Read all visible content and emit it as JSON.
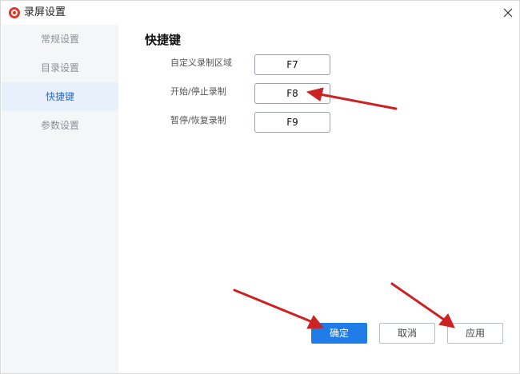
{
  "window": {
    "title": "录屏设置",
    "close_label": "✕"
  },
  "sidebar": {
    "items": [
      {
        "label": "常规设置",
        "active": false
      },
      {
        "label": "目录设置",
        "active": false
      },
      {
        "label": "快捷键",
        "active": true
      },
      {
        "label": "参数设置",
        "active": false
      }
    ]
  },
  "main": {
    "section_title": "快捷键",
    "hotkeys": [
      {
        "label": "自定义录制区域",
        "key": "F7"
      },
      {
        "label": "开始/停止录制",
        "key": "F8"
      },
      {
        "label": "暂停/恢复录制",
        "key": "F9"
      }
    ]
  },
  "footer": {
    "ok_label": "确定",
    "cancel_label": "取消",
    "apply_label": "应用"
  },
  "colors": {
    "accent": "#1f7ce6",
    "annotation_arrow": "#cc2222",
    "sidebar_bg": "#f5f6f8",
    "sidebar_active_bg": "#e7f0fb"
  }
}
